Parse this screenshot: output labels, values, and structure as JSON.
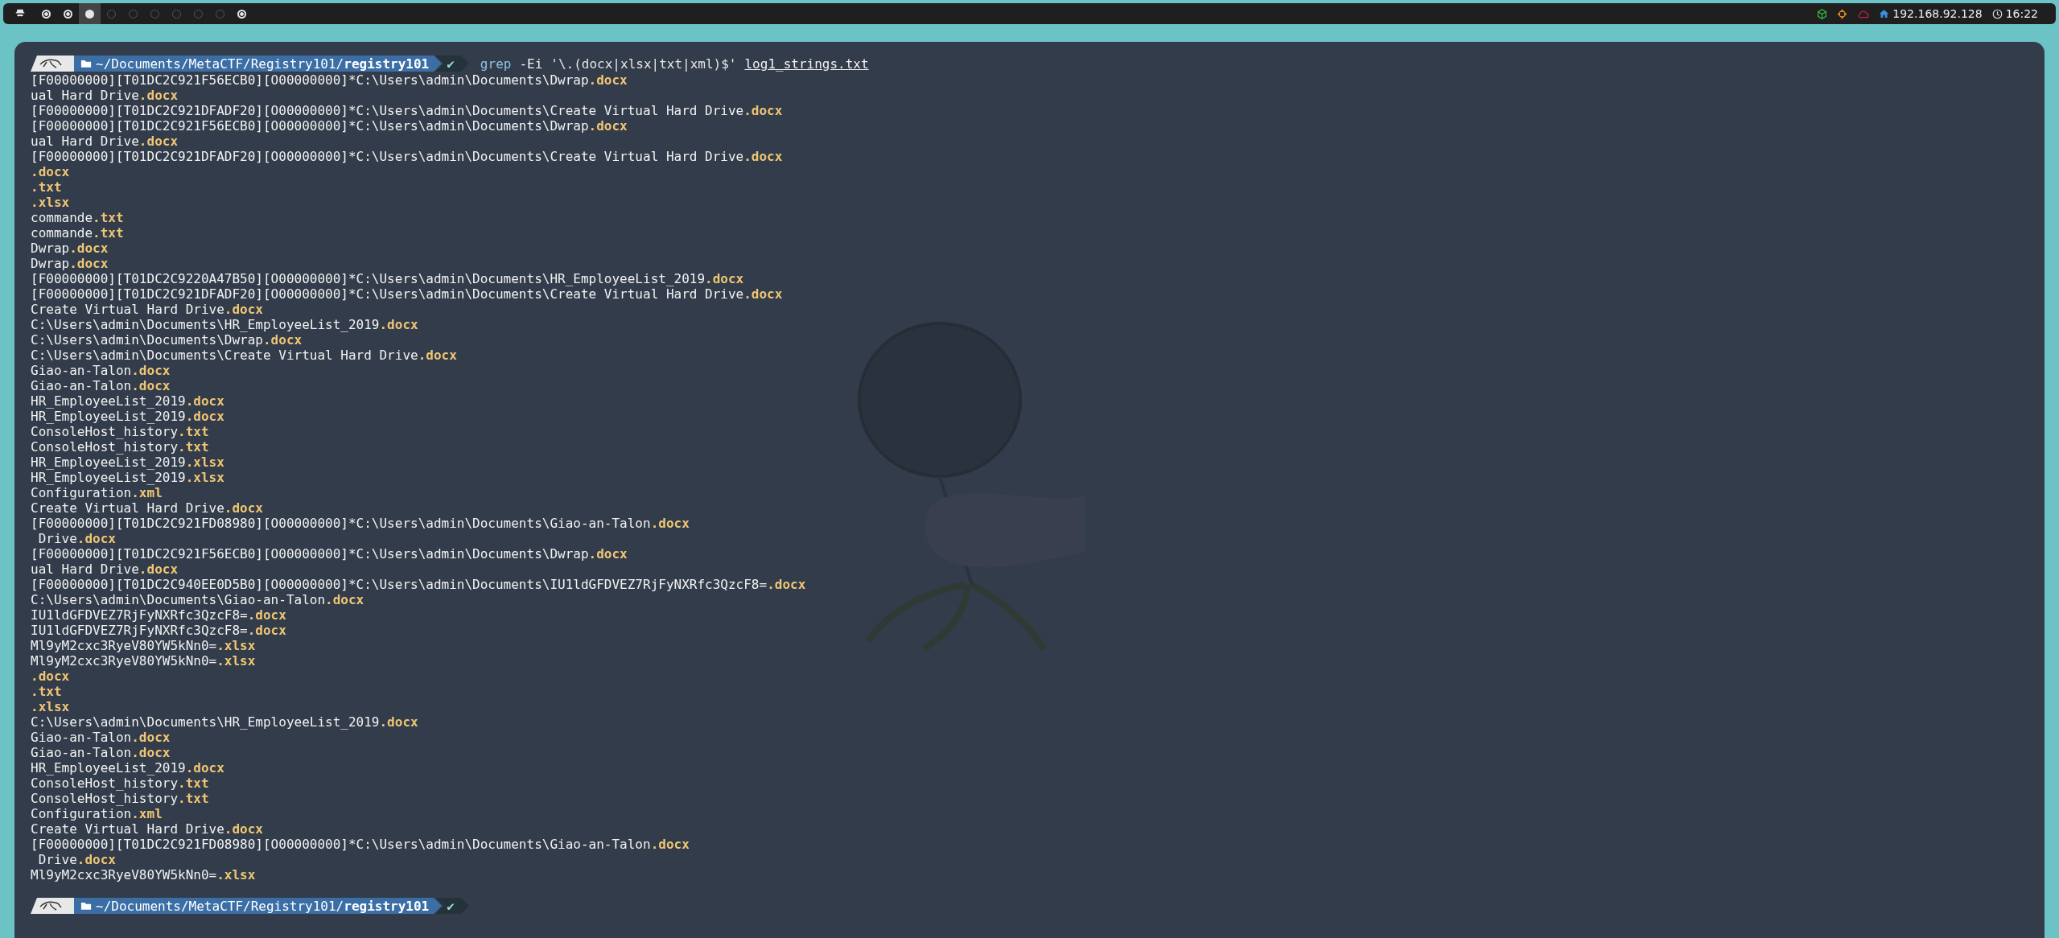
{
  "top_bar": {
    "workspaces": [
      {
        "selected": false,
        "occupied": true
      },
      {
        "selected": false,
        "occupied": true
      },
      {
        "selected": true
      },
      {
        "selected": false,
        "occupied": false
      },
      {
        "selected": false,
        "occupied": false
      },
      {
        "selected": false,
        "occupied": false
      },
      {
        "selected": false,
        "occupied": false
      },
      {
        "selected": false,
        "occupied": false
      },
      {
        "selected": false,
        "occupied": false
      },
      {
        "selected": false,
        "occupied": true
      }
    ],
    "ip_address": "192.168.92.128",
    "time": "16:22"
  },
  "terminal": {
    "prompt": {
      "path": "~/Documents/MetaCTF/Registry101/**registry101**",
      "status": "✔"
    },
    "command": [
      {
        "kind": "program",
        "text": "grep"
      },
      {
        "kind": "flag",
        "text": "-Ei"
      },
      {
        "kind": "string",
        "text": "'\\.(docx|xlsx|txt|xml)$'"
      },
      {
        "kind": "file",
        "text": "log1_strings.txt"
      }
    ],
    "output": [
      {
        "text": "[F00000000][T01DC2C921F56ECB0][O00000000]*C:\\Users\\admin\\Documents\\Dwrap",
        "match": ".docx"
      },
      {
        "text": "ual Hard Drive",
        "match": ".docx"
      },
      {
        "text": "[F00000000][T01DC2C921DFADF20][O00000000]*C:\\Users\\admin\\Documents\\Create Virtual Hard Drive",
        "match": ".docx"
      },
      {
        "text": "[F00000000][T01DC2C921F56ECB0][O00000000]*C:\\Users\\admin\\Documents\\Dwrap",
        "match": ".docx"
      },
      {
        "text": "ual Hard Drive",
        "match": ".docx"
      },
      {
        "text": "[F00000000][T01DC2C921DFADF20][O00000000]*C:\\Users\\admin\\Documents\\Create Virtual Hard Drive",
        "match": ".docx"
      },
      {
        "match": ".docx"
      },
      {
        "match": ".txt"
      },
      {
        "match": ".xlsx"
      },
      {
        "text": "commande",
        "match": ".txt"
      },
      {
        "text": "commande",
        "match": ".txt"
      },
      {
        "text": "Dwrap",
        "match": ".docx"
      },
      {
        "text": "Dwrap",
        "match": ".docx"
      },
      {
        "text": "[F00000000][T01DC2C9220A47B50][O00000000]*C:\\Users\\admin\\Documents\\HR_EmployeeList_2019",
        "match": ".docx"
      },
      {
        "text": "[F00000000][T01DC2C921DFADF20][O00000000]*C:\\Users\\admin\\Documents\\Create Virtual Hard Drive",
        "match": ".docx"
      },
      {
        "text": "Create Virtual Hard Drive",
        "match": ".docx"
      },
      {
        "text": "C:\\Users\\admin\\Documents\\HR_EmployeeList_2019",
        "match": ".docx"
      },
      {
        "text": "C:\\Users\\admin\\Documents\\Dwrap",
        "match": ".docx"
      },
      {
        "text": "C:\\Users\\admin\\Documents\\Create Virtual Hard Drive",
        "match": ".docx"
      },
      {
        "text": "Giao-an-Talon",
        "match": ".docx"
      },
      {
        "text": "Giao-an-Talon",
        "match": ".docx"
      },
      {
        "text": "HR_EmployeeList_2019",
        "match": ".docx"
      },
      {
        "text": "HR_EmployeeList_2019",
        "match": ".docx"
      },
      {
        "text": "ConsoleHost_history",
        "match": ".txt"
      },
      {
        "text": "ConsoleHost_history",
        "match": ".txt"
      },
      {
        "text": "HR_EmployeeList_2019",
        "match": ".xlsx"
      },
      {
        "text": "HR_EmployeeList_2019",
        "match": ".xlsx"
      },
      {
        "text": "Configuration",
        "match": ".xml"
      },
      {
        "text": "Create Virtual Hard Drive",
        "match": ".docx"
      },
      {
        "text": "[F00000000][T01DC2C921FD08980][O00000000]*C:\\Users\\admin\\Documents\\Giao-an-Talon",
        "match": ".docx"
      },
      {
        "text": " Drive",
        "match": ".docx"
      },
      {
        "text": "[F00000000][T01DC2C921F56ECB0][O00000000]*C:\\Users\\admin\\Documents\\Dwrap",
        "match": ".docx"
      },
      {
        "text": "ual Hard Drive",
        "match": ".docx"
      },
      {
        "text": "[F00000000][T01DC2C940EE0D5B0][O00000000]*C:\\Users\\admin\\Documents\\IU1ldGFDVEZ7RjFyNXRfc3QzcF8=",
        "match": ".docx"
      },
      {
        "text": "C:\\Users\\admin\\Documents\\Giao-an-Talon",
        "match": ".docx"
      },
      {
        "text": "IU1ldGFDVEZ7RjFyNXRfc3QzcF8=",
        "match": ".docx"
      },
      {
        "text": "IU1ldGFDVEZ7RjFyNXRfc3QzcF8=",
        "match": ".docx"
      },
      {
        "text": "Ml9yM2cxc3RyeV80YW5kNn0=",
        "match": ".xlsx"
      },
      {
        "text": "Ml9yM2cxc3RyeV80YW5kNn0=",
        "match": ".xlsx"
      },
      {
        "match": ".docx"
      },
      {
        "match": ".txt"
      },
      {
        "match": ".xlsx"
      },
      {
        "text": "C:\\Users\\admin\\Documents\\HR_EmployeeList_2019",
        "match": ".docx"
      },
      {
        "text": "Giao-an-Talon",
        "match": ".docx"
      },
      {
        "text": "Giao-an-Talon",
        "match": ".docx"
      },
      {
        "text": "HR_EmployeeList_2019",
        "match": ".docx"
      },
      {
        "text": "ConsoleHost_history",
        "match": ".txt"
      },
      {
        "text": "ConsoleHost_history",
        "match": ".txt"
      },
      {
        "text": "Configuration",
        "match": ".xml"
      },
      {
        "text": "Create Virtual Hard Drive",
        "match": ".docx"
      },
      {
        "text": "[F00000000][T01DC2C921FD08980][O00000000]*C:\\Users\\admin\\Documents\\Giao-an-Talon",
        "match": ".docx"
      },
      {
        "text": " Drive",
        "match": ".docx"
      },
      {
        "text": "Ml9yM2cxc3RyeV80YW5kNn0=",
        "match": ".xlsx"
      }
    ],
    "next_prompt": {
      "path": "~/Documents/MetaCTF/Registry101/**registry101**",
      "status": "✔"
    }
  }
}
